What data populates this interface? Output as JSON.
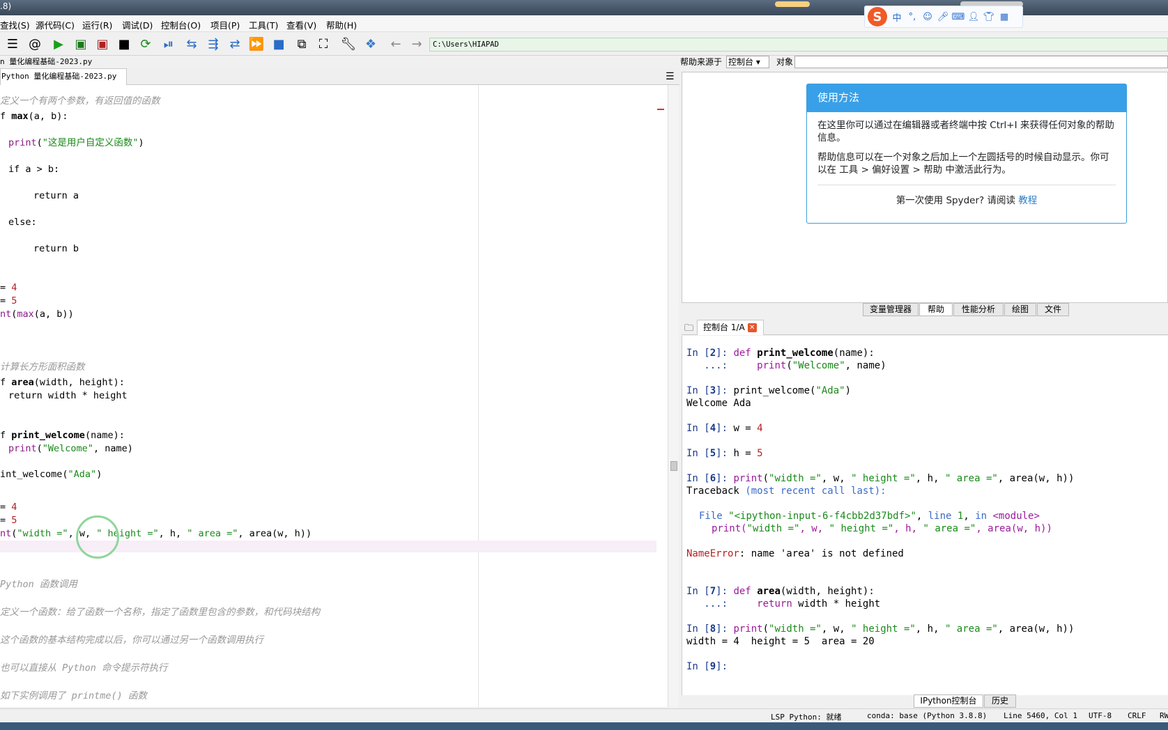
{
  "window": {
    "title_fragment": ".8)"
  },
  "menu": [
    "查找(S)",
    "源代码(C)",
    "运行(R)",
    "调试(D)",
    "控制台(O)",
    "项目(P)",
    "工具(T)",
    "查看(V)",
    "帮助(H)"
  ],
  "toolbar": {
    "path": "C:\\Users\\HIAPAD"
  },
  "ime": {
    "logo": "S",
    "lang": "中"
  },
  "editor": {
    "file_path": "n 量化编程基础-2023.py",
    "tab_label": "Python 量化编程基础-2023.py",
    "lines": [
      "定义一个有两个参数，有返回值的函数",
      "f max(a, b):",
      "print(\"这是用户自定义函数\")",
      "if a > b:",
      "return a",
      "else:",
      "return b",
      "= 4",
      "= 5",
      "nt(max(a, b))",
      "计算长方形面积函数",
      "f area(width, height):",
      "return width * height",
      "f print_welcome(name):",
      "print(\"Welcome\", name)",
      "int_welcome(\"Ada\")",
      "= 4",
      "= 5",
      "nt(\"width =\", w, \" height =\", h, \" area =\", area(w, h))",
      "Python 函数调用",
      "定义一个函数：给了函数一个名称，指定了函数里包含的参数，和代码块结构",
      "这个函数的基本结构完成以后，你可以通过另一个函数调用执行",
      "也可以直接从 Python 命令提示符执行",
      "如下实例调用了 printme() 函数"
    ]
  },
  "help": {
    "source_label": "帮助来源于",
    "source_value": "控制台",
    "object_label": "对象",
    "card_title": "使用方法",
    "para1": "在这里你可以通过在编辑器或者终端中按 Ctrl+I 来获得任何对象的帮助信息。",
    "para2": "帮助信息可以在一个对象之后加上一个左圆括号的时候自动显示。你可以在 工具 > 偏好设置 > 帮助 中激活此行为。",
    "foot_text": "第一次使用 Spyder? 请阅读",
    "foot_link": "教程"
  },
  "right_tabs": [
    "变量管理器",
    "帮助",
    "性能分析",
    "绘图",
    "文件"
  ],
  "console": {
    "tab_label": "控制台 1/A",
    "lines": [
      "In [2]: def print_welcome(name):",
      "   ...:     print(\"Welcome\", name)",
      "In [3]: print_welcome(\"Ada\")",
      "Welcome Ada",
      "In [4]: w = 4",
      "In [5]: h = 5",
      "In [6]: print(\"width =\", w, \" height =\", h, \" area =\", area(w, h))",
      "Traceback (most recent call last):",
      "  File \"<ipython-input-6-f4cbb2d37bdf>\", line 1, in <module>",
      "    print(\"width =\", w, \" height =\", h, \" area =\", area(w, h))",
      "NameError: name 'area' is not defined",
      "In [7]: def area(width, height):",
      "   ...:     return width * height",
      "In [8]: print(\"width =\", w, \" height =\", h, \" area =\", area(w, h))",
      "width = 4  height = 5  area = 20",
      "In [9]:"
    ]
  },
  "bottom_tabs": [
    "IPython控制台",
    "历史"
  ],
  "status": {
    "lsp": "LSP Python: 就绪",
    "conda": "conda: base (Python 3.8.8)",
    "position": "Line 5460, Col 1",
    "encoding": "UTF-8",
    "eol": "CRLF",
    "rw": "RW"
  }
}
